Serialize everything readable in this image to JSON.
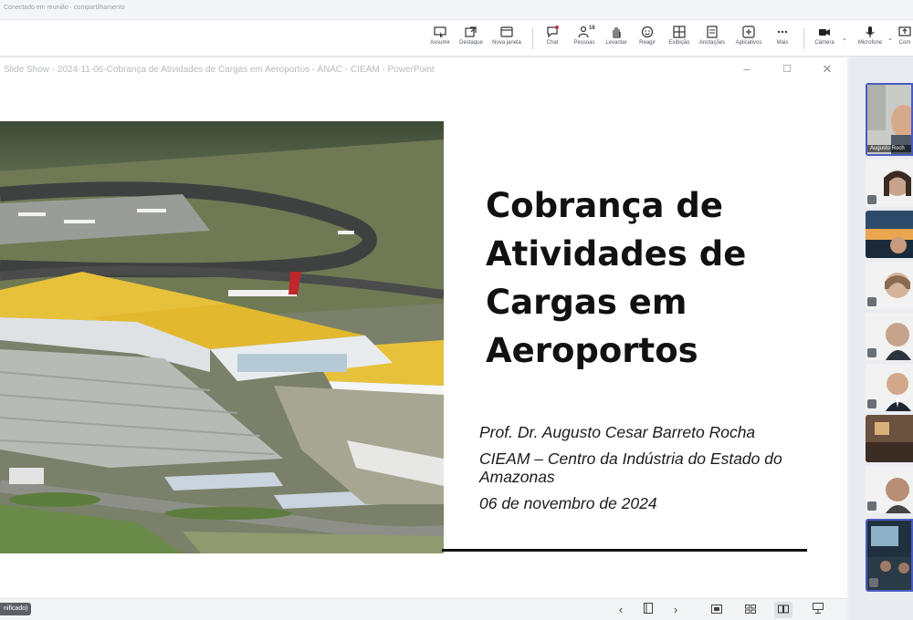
{
  "top_hint": "Conectado em reunião · compartilhamento",
  "toolbar": {
    "items": [
      {
        "label": "Assumir",
        "icon": "take-control-icon"
      },
      {
        "label": "Destaque",
        "icon": "pop-out-icon"
      },
      {
        "label": "Nova janela",
        "icon": "new-window-icon"
      },
      {
        "label": "Chat",
        "icon": "chat-icon"
      },
      {
        "label": "Pessoas",
        "icon": "people-icon",
        "badge": "16"
      },
      {
        "label": "Levantar",
        "icon": "raise-hand-icon"
      },
      {
        "label": "Reagir",
        "icon": "react-icon"
      },
      {
        "label": "Exibição",
        "icon": "view-icon"
      },
      {
        "label": "Anotações",
        "icon": "notes-icon"
      },
      {
        "label": "Aplicativos",
        "icon": "apps-icon"
      },
      {
        "label": "Mais",
        "icon": "more-icon"
      },
      {
        "label": "Câmera",
        "icon": "camera-icon"
      },
      {
        "label": "Microfone",
        "icon": "microphone-icon"
      },
      {
        "label": "Com",
        "icon": "share-icon"
      }
    ]
  },
  "window": {
    "title": "Slide Show  -  2024-11-06-Cobrança de Atividades de Cargas em Aeroportos - ANAC - CIEAM - PowerPoint"
  },
  "slide": {
    "title_lines": [
      "Cobrança de",
      "Atividades de",
      "Cargas em",
      "Aeroportos"
    ],
    "author": "Prof. Dr. Augusto Cesar Barreto Rocha",
    "org": "CIEAM – Centro da Indústria do Estado do Amazonas",
    "date": "06 de novembro de 2024"
  },
  "status": {
    "left_tag": "nificado)"
  },
  "participants": {
    "selected_name": "Augusto Roch",
    "count_visible": 10
  },
  "colors": {
    "accent": "#4a5cc2",
    "roof": "#e8c13a"
  }
}
